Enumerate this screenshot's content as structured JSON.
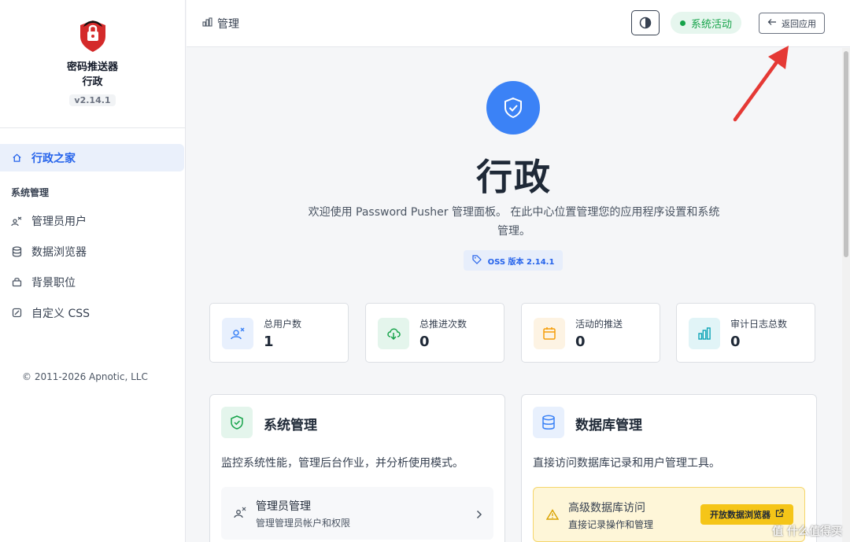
{
  "sidebar": {
    "brand_line1": "密码推送器",
    "brand_line2": "行政",
    "version": "v2.14.1",
    "items": [
      {
        "label": "行政之家",
        "icon": "home-icon",
        "active": true
      },
      {
        "label": "管理员用户",
        "icon": "user-admin-icon"
      },
      {
        "label": "数据浏览器",
        "icon": "database-icon"
      },
      {
        "label": "背景职位",
        "icon": "jobs-icon"
      },
      {
        "label": "自定义 CSS",
        "icon": "css-icon"
      }
    ],
    "section_label": "系统管理",
    "copyright": "© 2011-2026 Apnotic, LLC"
  },
  "header": {
    "breadcrumb": "管理",
    "status": "系统活动",
    "back_label": "返回应用"
  },
  "hero": {
    "title": "行政",
    "description": "欢迎使用 Password Pusher 管理面板。 在此中心位置管理您的应用程序设置和系统管理。",
    "oss_badge": "OSS 版本 2.14.1"
  },
  "stats": [
    {
      "label": "总用户数",
      "value": "1",
      "icon": "users-icon",
      "color": "#3b82f6",
      "bg": "#e8f0fd"
    },
    {
      "label": "总推进次数",
      "value": "0",
      "icon": "cloud-download-icon",
      "color": "#16a34a",
      "bg": "#e4f5ec"
    },
    {
      "label": "活动的推送",
      "value": "0",
      "icon": "calendar-icon",
      "color": "#f59e0b",
      "bg": "#fdf3e3"
    },
    {
      "label": "审计日志总数",
      "value": "0",
      "icon": "bar-chart-icon",
      "color": "#0ea5b7",
      "bg": "#e1f4f7"
    }
  ],
  "cards": {
    "system": {
      "title": "系统管理",
      "description": "监控系统性能，管理后台作业，并分析使用模式。",
      "row_title": "管理员管理",
      "row_sub": "管理管理员帐户和权限"
    },
    "database": {
      "title": "数据库管理",
      "description": "直接访问数据库记录和用户管理工具。",
      "warn_title": "高级数据库访问",
      "warn_sub": "直接记录操作和管理",
      "warn_button": "开放数据浏览器"
    }
  },
  "watermark": "值 什么值得买",
  "colors": {
    "accent": "#3b82f6",
    "success": "#16a34a",
    "warning": "#f5c518"
  }
}
